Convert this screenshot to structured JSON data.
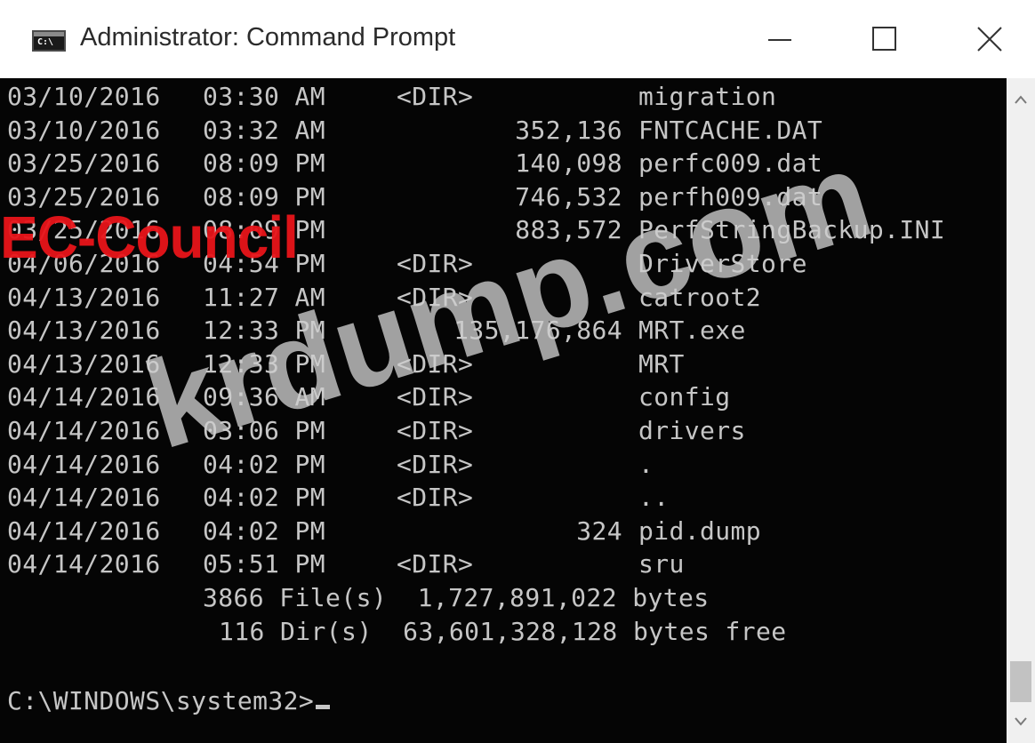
{
  "window": {
    "title": "Administrator: Command Prompt",
    "icon": "console-app-icon",
    "controls": {
      "minimize": "minimize-icon",
      "maximize": "maximize-icon",
      "close": "close-icon"
    }
  },
  "console": {
    "background": "#050505",
    "text_color": "#c6c6c6",
    "rows": [
      {
        "date": "03/10/2016",
        "time": "03:30 AM",
        "dir": "<DIR>",
        "size": "",
        "name": "migration"
      },
      {
        "date": "03/10/2016",
        "time": "03:32 AM",
        "dir": "",
        "size": "352,136",
        "name": "FNTCACHE.DAT"
      },
      {
        "date": "03/25/2016",
        "time": "08:09 PM",
        "dir": "",
        "size": "140,098",
        "name": "perfc009.dat"
      },
      {
        "date": "03/25/2016",
        "time": "08:09 PM",
        "dir": "",
        "size": "746,532",
        "name": "perfh009.dat"
      },
      {
        "date": "03/25/2016",
        "time": "08:09 PM",
        "dir": "",
        "size": "883,572",
        "name": "PerfStringBackup.INI"
      },
      {
        "date": "04/06/2016",
        "time": "04:54 PM",
        "dir": "<DIR>",
        "size": "",
        "name": "DriverStore"
      },
      {
        "date": "04/13/2016",
        "time": "11:27 AM",
        "dir": "<DIR>",
        "size": "",
        "name": "catroot2"
      },
      {
        "date": "04/13/2016",
        "time": "12:33 PM",
        "dir": "",
        "size": "135,176,864",
        "name": "MRT.exe"
      },
      {
        "date": "04/13/2016",
        "time": "12:33 PM",
        "dir": "<DIR>",
        "size": "",
        "name": "MRT"
      },
      {
        "date": "04/14/2016",
        "time": "09:36 AM",
        "dir": "<DIR>",
        "size": "",
        "name": "config"
      },
      {
        "date": "04/14/2016",
        "time": "03:06 PM",
        "dir": "<DIR>",
        "size": "",
        "name": "drivers"
      },
      {
        "date": "04/14/2016",
        "time": "04:02 PM",
        "dir": "<DIR>",
        "size": "",
        "name": "."
      },
      {
        "date": "04/14/2016",
        "time": "04:02 PM",
        "dir": "<DIR>",
        "size": "",
        "name": ".."
      },
      {
        "date": "04/14/2016",
        "time": "04:02 PM",
        "dir": "",
        "size": "324",
        "name": "pid.dump"
      },
      {
        "date": "04/14/2016",
        "time": "05:51 PM",
        "dir": "<DIR>",
        "size": "",
        "name": "sru"
      }
    ],
    "summary": {
      "files": "3866 File(s)  1,727,891,022 bytes",
      "dirs": "116 Dir(s)  63,601,328,128 bytes free"
    },
    "prompt": "C:\\WINDOWS\\system32>"
  },
  "scrollbar": {
    "up": "scroll-up-arrow-icon",
    "down": "scroll-down-arrow-icon"
  },
  "watermarks": {
    "brand": "EC-Council",
    "site": "krdump.com"
  }
}
